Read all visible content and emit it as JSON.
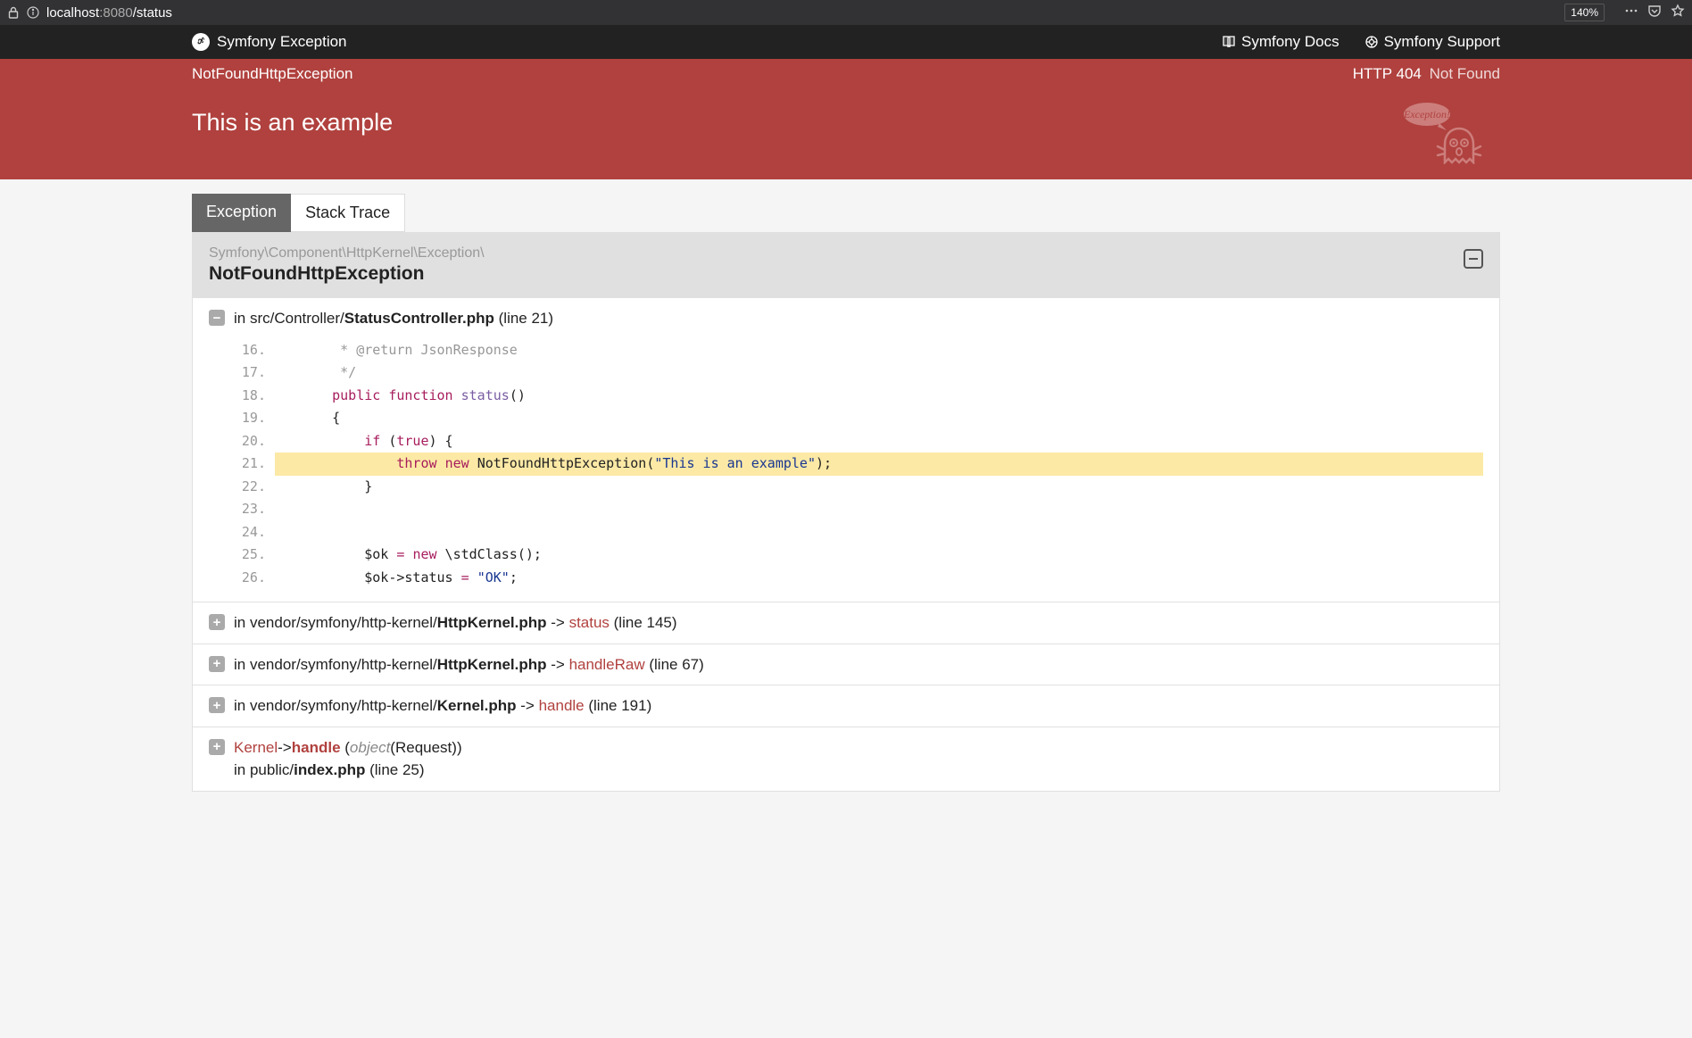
{
  "browser": {
    "url_host": "localhost",
    "url_port": ":8080",
    "url_path": "/status",
    "zoom": "140%"
  },
  "header": {
    "title": "Symfony Exception",
    "docs_label": "Symfony Docs",
    "support_label": "Symfony Support"
  },
  "status": {
    "exception_short": "NotFoundHttpException",
    "http_label": "HTTP 404",
    "http_text": "Not Found"
  },
  "message": "This is an example",
  "tabs": {
    "exception": "Exception",
    "trace": "Stack Trace"
  },
  "panel": {
    "namespace": "Symfony\\Component\\HttpKernel\\Exception\\",
    "classname": "NotFoundHttpException"
  },
  "frame0": {
    "in": "in ",
    "path": "src/Controller/",
    "file": "StatusController.php",
    "line_label": " (line 21)"
  },
  "code": {
    "l16n": "16.",
    "l16": "     * @return JsonResponse",
    "l17n": "17.",
    "l17": "     */",
    "l18n": "18.",
    "l18_pre": "    ",
    "l18_kw1": "public",
    "l18_sp1": " ",
    "l18_kw2": "function",
    "l18_sp2": " ",
    "l18_fn": "status",
    "l18_post": "()",
    "l19n": "19.",
    "l19": "    {",
    "l20n": "20.",
    "l20_pre": "        ",
    "l20_kw": "if",
    "l20_sp": " (",
    "l20_true": "true",
    "l20_post": ") {",
    "l21n": "21.",
    "l21_pre": "            ",
    "l21_kw1": "throw",
    "l21_sp1": " ",
    "l21_kw2": "new",
    "l21_sp2": " ",
    "l21_cls": "NotFoundHttpException(",
    "l21_str": "\"This is an example\"",
    "l21_post": ");",
    "l22n": "22.",
    "l22": "        }",
    "l23n": "23.",
    "l23": "",
    "l24n": "24.",
    "l24": "",
    "l25n": "25.",
    "l25_pre": "        $ok ",
    "l25_eq": "=",
    "l25_sp": " ",
    "l25_kw": "new",
    "l25_post": " \\stdClass();",
    "l26n": "26.",
    "l26_pre": "        $ok->status ",
    "l26_eq": "=",
    "l26_sp": " ",
    "l26_str": "\"OK\"",
    "l26_post": ";"
  },
  "frame1": {
    "in": "in ",
    "path": "vendor/symfony/http-kernel/",
    "file": "HttpKernel.php",
    "arrow": " -> ",
    "method": "status",
    "line_label": " (line 145)"
  },
  "frame2": {
    "in": "in ",
    "path": "vendor/symfony/http-kernel/",
    "file": "HttpKernel.php",
    "arrow": " -> ",
    "method": "handleRaw",
    "line_label": " (line 67)"
  },
  "frame3": {
    "in": "in ",
    "path": "vendor/symfony/http-kernel/",
    "file": "Kernel.php",
    "arrow": " -> ",
    "method": "handle",
    "line_label": " (line 191)"
  },
  "frame4": {
    "class": "Kernel",
    "arrow1": "->",
    "method": "handle",
    "args_open": " (",
    "obj": "object",
    "req": "(Request)",
    "args_close": ")",
    "in": "in ",
    "path": "public/",
    "file": "index.php",
    "line_label": " (line 25)"
  }
}
